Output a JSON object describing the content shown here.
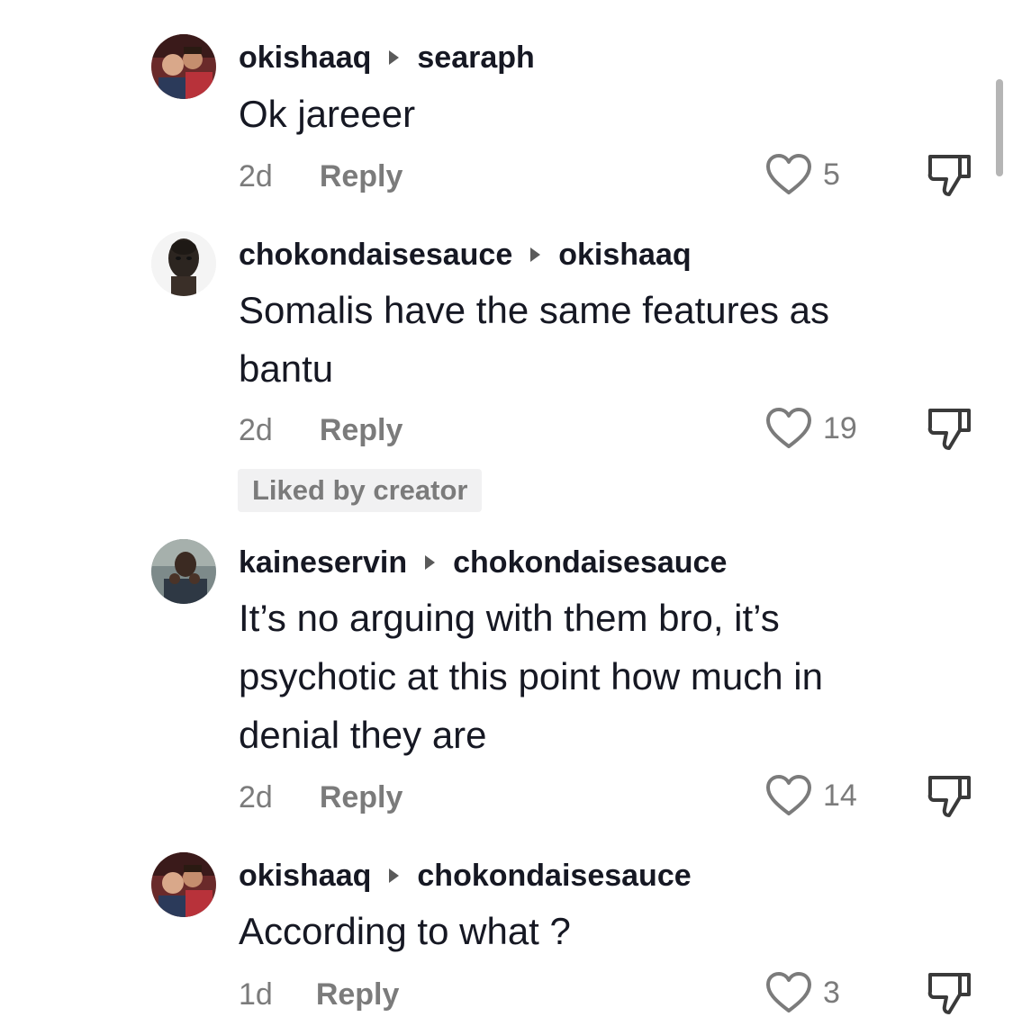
{
  "comments": [
    {
      "author": "okishaaq",
      "reply_to": "searaph",
      "text": "Ok jareeer",
      "time": "2d",
      "reply_label": "Reply",
      "likes": "5",
      "liked_by_creator": ""
    },
    {
      "author": "chokondaisesauce",
      "reply_to": "okishaaq",
      "text": "Somalis have the same features as bantu",
      "time": "2d",
      "reply_label": "Reply",
      "likes": "19",
      "liked_by_creator": "Liked by creator"
    },
    {
      "author": "kaineservin",
      "reply_to": "chokondaisesauce",
      "text": "It’s no arguing with them bro, it’s psychotic at this point how much in denial they are",
      "time": "2d",
      "reply_label": "Reply",
      "likes": "14",
      "liked_by_creator": ""
    },
    {
      "author": "okishaaq",
      "reply_to": "chokondaisesauce",
      "text": "According to what ?",
      "time": "1d",
      "reply_label": "Reply",
      "likes": "3",
      "liked_by_creator": ""
    }
  ],
  "icons": {
    "like": "heart-outline-icon",
    "dislike": "thumbs-down-outline-icon",
    "reply_arrow": "caret-right-icon"
  },
  "colors": {
    "text_primary": "#161823",
    "text_secondary": "#7b7b7b",
    "badge_bg": "#f1f1f2"
  }
}
